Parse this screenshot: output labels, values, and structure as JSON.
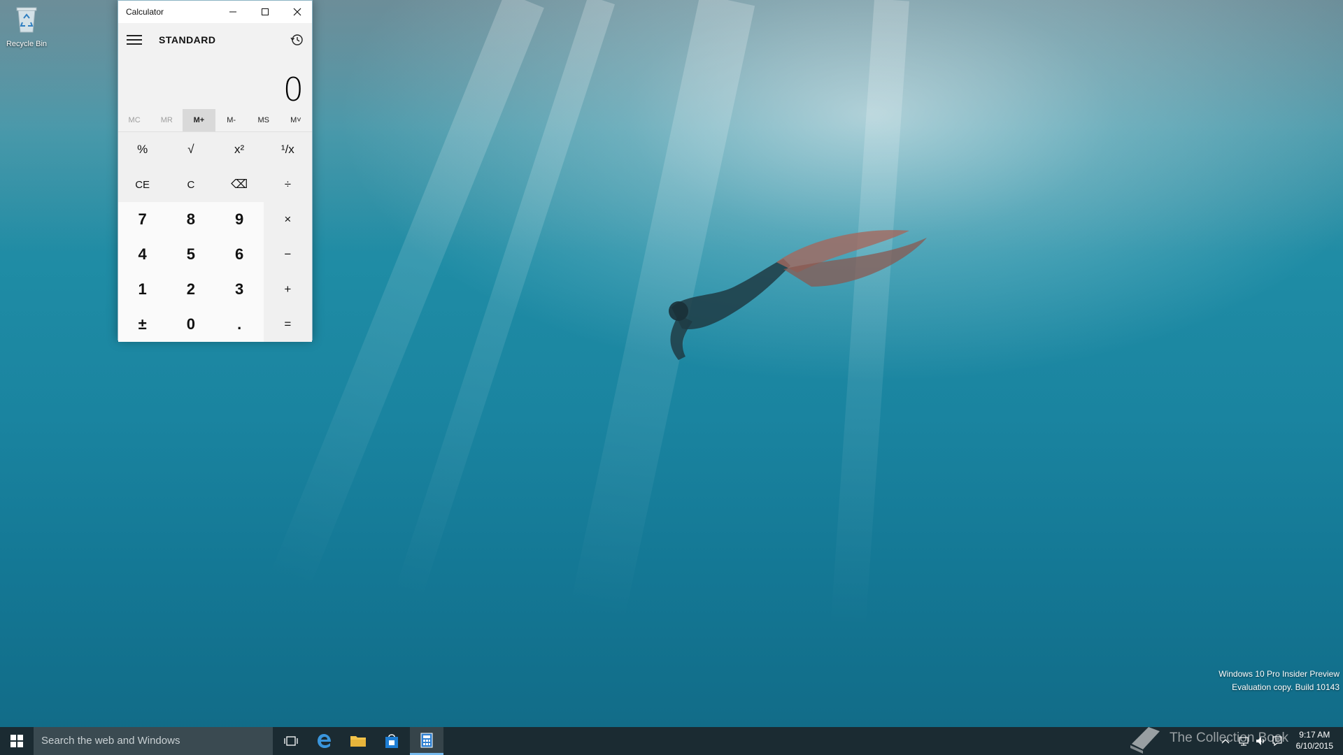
{
  "desktop": {
    "recycle_bin_label": "Recycle Bin",
    "watermark_line1": "Windows 10 Pro Insider Preview",
    "watermark_line2": "Evaluation copy. Build 10143"
  },
  "calculator": {
    "window_title": "Calculator",
    "mode": "STANDARD",
    "display_value": "0",
    "memory_buttons": [
      "MC",
      "MR",
      "M+",
      "M-",
      "MS",
      "M˅"
    ],
    "function_keys": [
      "%",
      "√",
      "x²",
      "¹/x"
    ],
    "clear_row": [
      "CE",
      "C",
      "⌫",
      "÷"
    ],
    "row_789": [
      "7",
      "8",
      "9",
      "×"
    ],
    "row_456": [
      "4",
      "5",
      "6",
      "−"
    ],
    "row_123": [
      "1",
      "2",
      "3",
      "+"
    ],
    "row_bottom": [
      "±",
      "0",
      ".",
      "="
    ]
  },
  "taskbar": {
    "search_placeholder": "Search the web and Windows",
    "watermark_brand": "The Collection Book",
    "time": "9:17 AM",
    "date": "6/10/2015"
  },
  "colors": {
    "taskbar_bg": "#1b2b32",
    "accent": "#76b9ed",
    "calc_bg": "#e6e6e6"
  }
}
